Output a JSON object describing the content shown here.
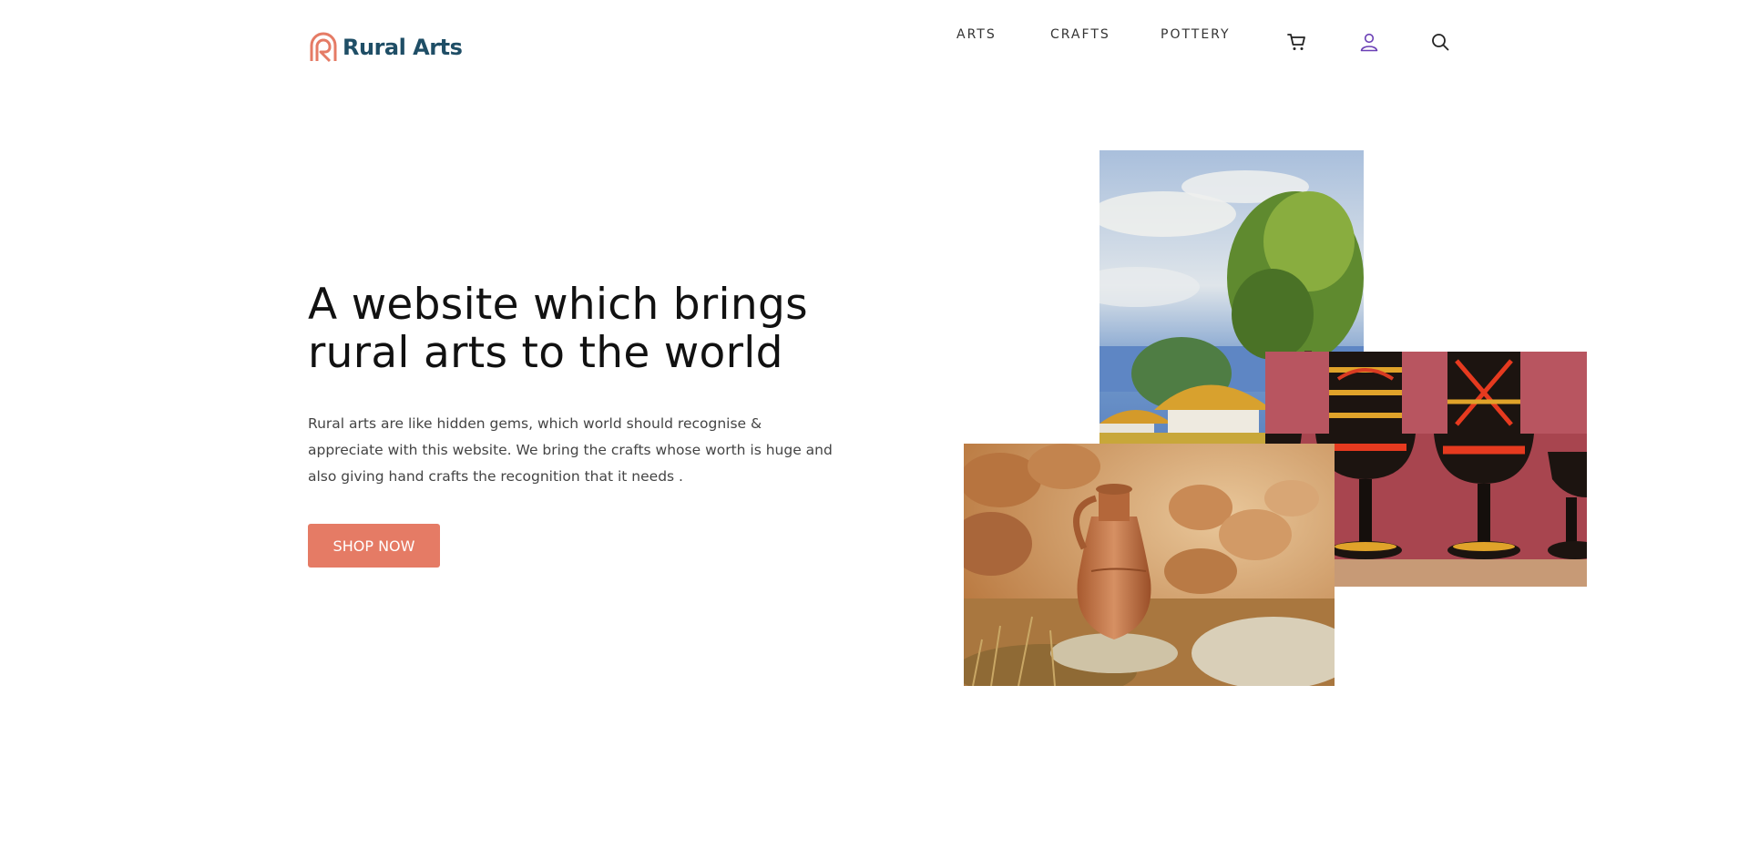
{
  "brand": {
    "name": "Rural Arts",
    "logo_icon": "rainbow-r-logo-icon",
    "colors": {
      "text": "#1f4e66",
      "mark": "#e57b65"
    }
  },
  "nav": {
    "links": [
      "ARTS",
      "CRAFTS",
      "POTTERY"
    ],
    "icons": [
      "cart-icon",
      "user-icon",
      "search-icon"
    ]
  },
  "hero": {
    "title": "A website which brings rural arts to the world",
    "description": "Rural arts are like hidden gems, which world should recognise & appreciate with this website. We bring the crafts whose worth is huge and also giving hand crafts the recognition that it needs .",
    "cta_label": "SHOP NOW",
    "cta_color": "#e57b65"
  },
  "collage": [
    {
      "subject": "landscape painting of a thatched cottage under a tree"
    },
    {
      "subject": "painted red and black wooden goblets"
    },
    {
      "subject": "clay jug on a stone with stacked pots behind"
    }
  ]
}
